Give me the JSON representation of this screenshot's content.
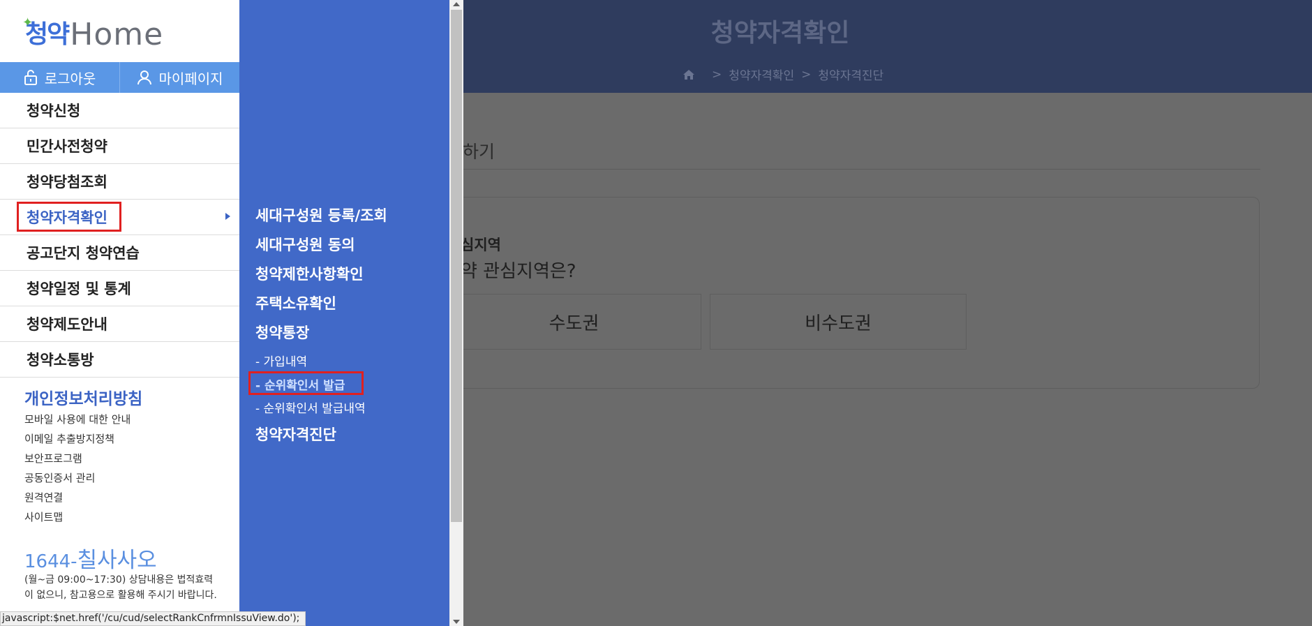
{
  "background": {
    "page_title": "청약자격확인",
    "breadcrumb": [
      "청약자격확인",
      "청약자격진단"
    ],
    "section_title": "하기",
    "question_label": "심지역",
    "question_text": "약 관심지역은?",
    "options": [
      "수도권",
      "비수도권"
    ]
  },
  "logo": {
    "part1": "청약",
    "part2": "Home"
  },
  "top_bar": {
    "logout": "로그아웃",
    "mypage": "마이페이지"
  },
  "menu": {
    "items": [
      "청약신청",
      "민간사전청약",
      "청약당첨조회",
      "청약자격확인",
      "공고단지 청약연습",
      "청약일정 및 통계",
      "청약제도안내",
      "청약소통방"
    ],
    "active_index": 3
  },
  "privacy": "개인정보처리방침",
  "footer_links": [
    "모바일 사용에 대한 안내",
    "이메일 추출방지정책",
    "보안프로그램",
    "공동인증서 관리",
    "원격연결",
    "사이트맵"
  ],
  "phone": {
    "number": "1644-",
    "word": "칠사사오"
  },
  "hours": "(월~금 09:00~17:30) 상담내용은 법적효력이 없으니, 참고용으로 활용해 주시기 바랍니다.",
  "submenu": {
    "items": [
      "세대구성원 등록/조회",
      "세대구성원 동의",
      "청약제한사항확인",
      "주택소유확인",
      "청약통장"
    ],
    "sub_items": [
      "- 가입내역",
      "- 순위확인서 발급",
      "- 순위확인서 발급내역"
    ],
    "last_item": "청약자격진단"
  },
  "status_bar": "javascript:$net.href('/cu/cud/selectRankCnfrmnIssuView.do');",
  "colors": {
    "submenu_bg": "#4169c8",
    "topbar_bg": "#5a97e6",
    "highlight": "#e02020",
    "accent": "#3b63c4"
  }
}
